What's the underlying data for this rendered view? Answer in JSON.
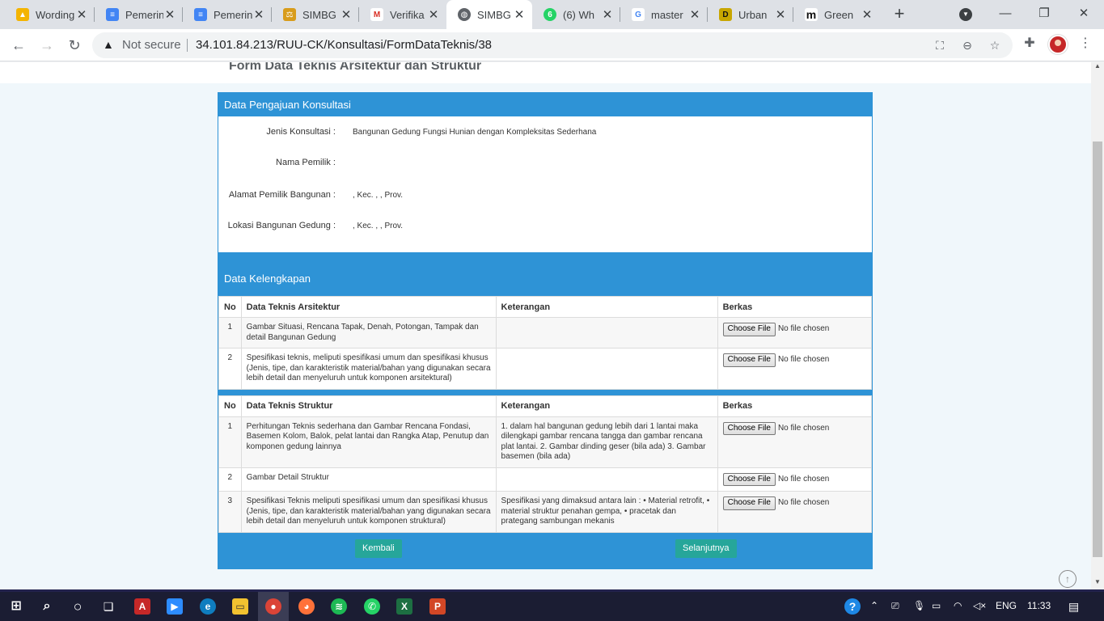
{
  "browser": {
    "tabs": [
      {
        "title": "Wording",
        "color": "#f4b400",
        "glyph": "▲"
      },
      {
        "title": "Pemerin",
        "color": "#4285f4",
        "glyph": "≡"
      },
      {
        "title": "Pemerin",
        "color": "#4285f4",
        "glyph": "≡"
      },
      {
        "title": "SIMBG",
        "color": "#d89c1b",
        "glyph": "⚖"
      },
      {
        "title": "Verifika",
        "color": "#ffffff",
        "glyph": "M"
      },
      {
        "title": "SIMBG",
        "color": "#5f6368",
        "glyph": "◍"
      },
      {
        "title": "(6) Wh",
        "color": "#25d366",
        "glyph": "6"
      },
      {
        "title": "master",
        "color": "#ffffff",
        "glyph": "G"
      },
      {
        "title": "Urban",
        "color": "#c8a600",
        "glyph": "D"
      },
      {
        "title": "Green",
        "color": "#ffffff",
        "glyph": "m"
      }
    ],
    "security_label": "Not secure",
    "url": "34.101.84.213/RUU-CK/Konsultasi/FormDataTeknis/38"
  },
  "page": {
    "title": "Form Data Teknis Arsitektur dan Struktur",
    "pengajuan": {
      "heading": "Data Pengajuan Konsultasi",
      "fields": [
        {
          "label": "Jenis Konsultasi :",
          "value": "Bangunan Gedung Fungsi Hunian dengan Kompleksitas Sederhana"
        },
        {
          "label": "Nama Pemilik :",
          "value": ""
        },
        {
          "label": "Alamat Pemilik Bangunan :",
          "value": ", Kec. , , Prov."
        },
        {
          "label": "Lokasi Bangunan Gedung :",
          "value": ", Kec. , , Prov."
        }
      ]
    },
    "kelengkapan": {
      "heading": "Data Kelengkapan",
      "arsitektur": {
        "headers": [
          "No",
          "Data Teknis Arsitektur",
          "Keterangan",
          "Berkas"
        ],
        "rows": [
          {
            "no": "1",
            "item": "Gambar Situasi, Rencana Tapak, Denah, Potongan, Tampak dan detail Bangunan Gedung",
            "ket": ""
          },
          {
            "no": "2",
            "item": "Spesifikasi teknis, meliputi spesifikasi umum dan spesifikasi khusus (Jenis, tipe, dan karakteristik material/bahan yang digunakan secara lebih detail dan menyeluruh untuk komponen arsitektural)",
            "ket": ""
          }
        ]
      },
      "struktur": {
        "headers": [
          "No",
          "Data Teknis Struktur",
          "Keterangan",
          "Berkas"
        ],
        "rows": [
          {
            "no": "1",
            "item": "Perhitungan Teknis sederhana dan Gambar Rencana Fondasi, Basemen Kolom, Balok, pelat lantai dan Rangka Atap, Penutup dan komponen gedung lainnya",
            "ket": "1. dalam hal bangunan gedung lebih dari 1 lantai maka dilengkapi gambar rencana tangga dan gambar rencana plat lantai. 2. Gambar dinding geser (bila ada) 3. Gambar basemen (bila ada)"
          },
          {
            "no": "2",
            "item": "Gambar Detail Struktur",
            "ket": ""
          },
          {
            "no": "3",
            "item": "Spesifikasi Teknis meliputi spesifikasi umum dan spesifikasi khusus (Jenis, tipe, dan karakteristik material/bahan yang digunakan secara lebih detail dan menyeluruh untuk komponen struktural)",
            "ket": "Spesifikasi yang dimaksud antara lain : • Material retrofit, • material struktur penahan gempa, • pracetak dan prategang sambungan mekanis"
          }
        ]
      },
      "file_button": "Choose File",
      "file_status": "No file chosen"
    },
    "buttons": {
      "back": "Kembali",
      "next": "Selanjutnya"
    }
  },
  "taskbar": {
    "language": "ENG",
    "time": "11:33"
  },
  "colors": {
    "primary": "#2e93d6",
    "button_green": "#26a69a",
    "taskbar": "#1b1d33"
  }
}
